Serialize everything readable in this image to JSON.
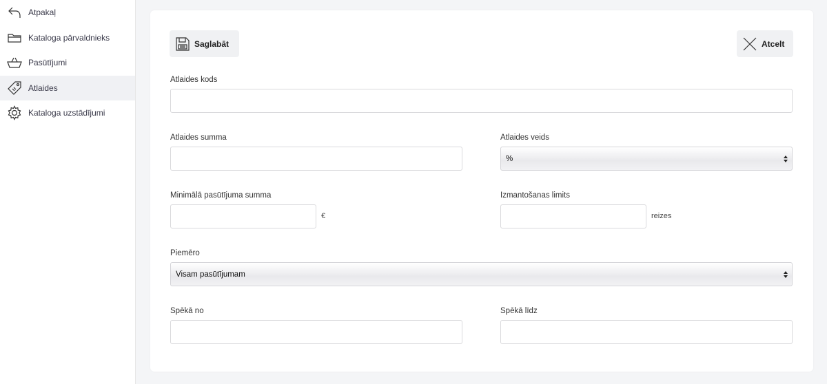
{
  "sidebar": {
    "items": [
      {
        "label": "Atpakaļ",
        "icon": "back-arrow-icon"
      },
      {
        "label": "Kataloga pārvaldnieks",
        "icon": "folder-icon"
      },
      {
        "label": "Pasūtījumi",
        "icon": "basket-icon"
      },
      {
        "label": "Atlaides",
        "icon": "tag-icon",
        "active": true
      },
      {
        "label": "Kataloga uzstādījumi",
        "icon": "gear-icon"
      }
    ]
  },
  "toolbar": {
    "save_label": "Saglabāt",
    "cancel_label": "Atcelt"
  },
  "form": {
    "code_label": "Atlaides kods",
    "code_value": "",
    "amount_label": "Atlaides summa",
    "amount_value": "",
    "type_label": "Atlaides veids",
    "type_value": "%",
    "min_order_label": "Minimālā pasūtījuma summa",
    "min_order_value": "",
    "min_order_suffix": "€",
    "usage_limit_label": "Izmantošanas limits",
    "usage_limit_value": "",
    "usage_limit_suffix": "reizes",
    "apply_label": "Piemēro",
    "apply_value": "Visam pasūtījumam",
    "valid_from_label": "Spēkā no",
    "valid_from_value": "",
    "valid_to_label": "Spēkā līdz",
    "valid_to_value": ""
  }
}
